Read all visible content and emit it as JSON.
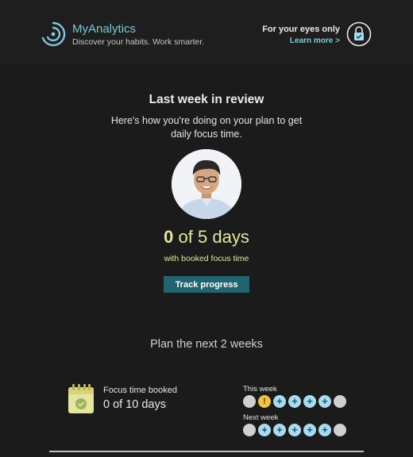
{
  "header": {
    "brand": "MyAnalytics",
    "tagline": "Discover your habits. Work smarter.",
    "privacy_text": "For your eyes only",
    "learn_more": "Learn more >"
  },
  "review": {
    "title": "Last week in review",
    "subtitle": "Here's how you're doing on your plan to get daily focus time.",
    "booked_count": "0",
    "booked_suffix": "of 5 days",
    "caption": "with booked focus time",
    "button_label": "Track progress"
  },
  "plan": {
    "title": "Plan the next 2 weeks",
    "focus_label": "Focus time booked",
    "focus_value": "0 of 10 days",
    "this_week_label": "This week",
    "next_week_label": "Next week",
    "this_week_days": [
      "empty",
      "warning",
      "add",
      "add",
      "add",
      "add",
      "empty"
    ],
    "next_week_days": [
      "empty",
      "add",
      "add",
      "add",
      "add",
      "add",
      "empty"
    ]
  },
  "colors": {
    "accent": "#7fc7d9",
    "highlight": "#e6e59f",
    "button": "#22636f",
    "day_add": "#a9dcee",
    "day_warning": "#f2c248",
    "day_empty": "#d0d0d0"
  },
  "icons": [
    "myanalytics-logo-icon",
    "lock-icon",
    "calendar-check-icon",
    "plus-icon",
    "warning-icon"
  ]
}
